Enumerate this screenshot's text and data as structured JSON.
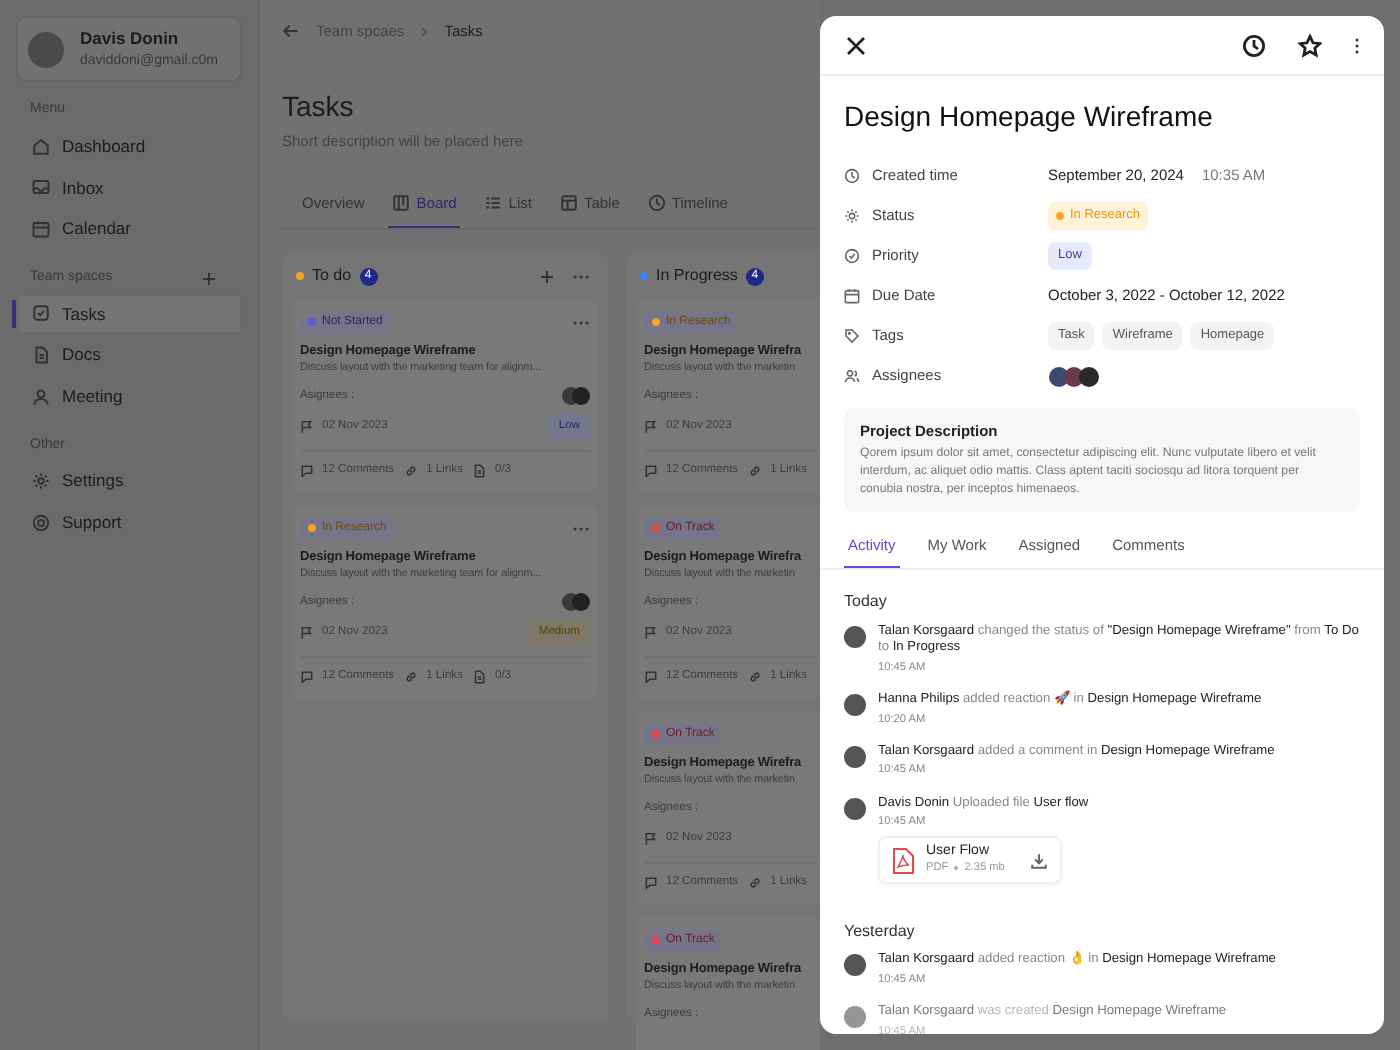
{
  "sidebar": {
    "user": {
      "name": "Davis Donin",
      "email": "daviddoni@gmail.c0m"
    },
    "sections": [
      {
        "heading": "Menu",
        "add": false,
        "items": [
          {
            "label": "Dashboard",
            "selected": false
          },
          {
            "label": "Inbox",
            "selected": false
          },
          {
            "label": "Calendar",
            "selected": false
          }
        ]
      },
      {
        "heading": "Team spaces",
        "add": true,
        "items": [
          {
            "label": "Tasks",
            "selected": true
          },
          {
            "label": "Docs",
            "selected": false
          },
          {
            "label": "Meeting",
            "selected": false
          }
        ]
      },
      {
        "heading": "Other",
        "add": false,
        "items": [
          {
            "label": "Settings",
            "selected": false
          },
          {
            "label": "Support",
            "selected": false
          }
        ]
      }
    ]
  },
  "main": {
    "breadcrumb": [
      "Team spcaes",
      "Tasks"
    ],
    "title": "Tasks",
    "description": "Short description will be placed here",
    "tabs": [
      {
        "label": "Overview",
        "selected": false
      },
      {
        "label": "Board",
        "selected": true
      },
      {
        "label": "List",
        "selected": false
      },
      {
        "label": "Table",
        "selected": false
      },
      {
        "label": "Timeline",
        "selected": false
      }
    ],
    "columns": [
      {
        "title": "To do",
        "count": "4",
        "color": "#f5a524",
        "actions": true,
        "cards": [
          {
            "status": {
              "label": "Not Started",
              "color": "#5b5bd6"
            },
            "menu": true,
            "title": "Design Homepage Wireframe",
            "description": "Discuss layout with the marketing team for alignm...",
            "assignees_label": "Asignees :",
            "avatars": true,
            "date": "02 Nov 2023",
            "priority": {
              "label": "Low",
              "kind": "low"
            },
            "comments": "12 Comments",
            "links": "1 Links",
            "subtasks": "0/3"
          },
          {
            "status": {
              "label": "In Research",
              "color": "#f5a524"
            },
            "menu": true,
            "title": "Design Homepage Wireframe",
            "description": "Discuss layout with the marketing team for alignm...",
            "assignees_label": "Asignees :",
            "avatars": true,
            "date": "02 Nov 2023",
            "priority": {
              "label": "Medium",
              "kind": "medium"
            },
            "comments": "12 Comments",
            "links": "1 Links",
            "subtasks": "0/3"
          }
        ]
      },
      {
        "title": "In Progress",
        "count": "4",
        "color": "#3b82f6",
        "actions": false,
        "cards": [
          {
            "status": {
              "label": "In Research",
              "color": "#f5a524"
            },
            "menu": false,
            "title": "Design Homepage Wirefra",
            "description": "Discuss layout with the marketin",
            "assignees_label": "Asignees :",
            "avatars": false,
            "date": "02 Nov 2023",
            "comments": "12 Comments",
            "links": "1 Links"
          },
          {
            "status": {
              "label": "On Track",
              "color": "#e5484d"
            },
            "menu": false,
            "title": "Design Homepage Wirefra",
            "description": "Discuss layout with the marketin",
            "assignees_label": "Asignees :",
            "avatars": false,
            "date": "02 Nov 2023",
            "comments": "12 Comments",
            "links": "1 Links"
          },
          {
            "status": {
              "label": "On Track",
              "color": "#e5484d"
            },
            "menu": false,
            "title": "Design Homepage Wirefra",
            "description": "Discuss layout with the marketin",
            "assignees_label": "Asignees :",
            "avatars": false,
            "date": "02 Nov 2023",
            "comments": "12 Comments",
            "links": "1 Links"
          },
          {
            "status": {
              "label": "On Track",
              "color": "#e5484d"
            },
            "menu": false,
            "title": "Design Homepage Wirefra",
            "description": "Discuss layout with the marketin",
            "assignees_label": "Asignees :",
            "avatars": false
          }
        ]
      }
    ]
  },
  "panel": {
    "title": "Design Homepage Wireframe",
    "fields": [
      {
        "label": "Created time",
        "kind": "datetime",
        "value": "September 20, 2024",
        "extra": "10:35 AM"
      },
      {
        "label": "Status",
        "kind": "status",
        "value": "In Research",
        "color": "#f5a524"
      },
      {
        "label": "Priority",
        "kind": "priority",
        "value": "Low"
      },
      {
        "label": "Due Date",
        "kind": "text",
        "value": "October 3, 2022 - October 12, 2022"
      },
      {
        "label": "Tags",
        "kind": "tags",
        "tags": [
          "Task",
          "Wireframe",
          "Homepage"
        ]
      },
      {
        "label": "Assignees",
        "kind": "avatars"
      }
    ],
    "description": {
      "title": "Project Description",
      "text": "Qorem ipsum dolor sit amet, consectetur adipiscing elit. Nunc vulputate libero et velit interdum, ac aliquet odio mattis. Class aptent taciti sociosqu ad litora torquent per conubia nostra, per inceptos himenaeos."
    },
    "tabs": [
      {
        "label": "Activity",
        "selected": true
      },
      {
        "label": "My Work",
        "selected": false
      },
      {
        "label": "Assigned",
        "selected": false
      },
      {
        "label": "Comments",
        "selected": false
      }
    ],
    "groups": [
      {
        "heading": "Today",
        "items": [
          {
            "text": "**Talan Korsgaard** changed the status of **\"Design Homepage Wireframe\"** from **To Do** to **In Progress**",
            "time": "10:45 AM",
            "faded": false
          },
          {
            "text": "**Hanna Philips** added reaction 🚀 in **Design Homepage Wireframe**",
            "time": "10:20 AM",
            "faded": false
          },
          {
            "text": "**Talan Korsgaard** added a comment in **Design Homepage Wireframe**",
            "time": "10:45 AM",
            "faded": false
          },
          {
            "text": "**Davis Donin** Uploaded file **User flow**",
            "time": "10:45 AM",
            "faded": false,
            "attachment": {
              "name": "User Flow",
              "type": "PDF",
              "size": "2.35 mb"
            }
          }
        ]
      },
      {
        "heading": "Yesterday",
        "items": [
          {
            "text": "**Talan Korsgaard** added reaction 👌 in **Design Homepage Wireframe**",
            "time": "10:45 AM",
            "faded": false
          },
          {
            "text": "**Talan Korsgaard** was created **Design Homepage Wireframe**",
            "time": "10:45 AM",
            "faded": true
          }
        ]
      }
    ]
  }
}
